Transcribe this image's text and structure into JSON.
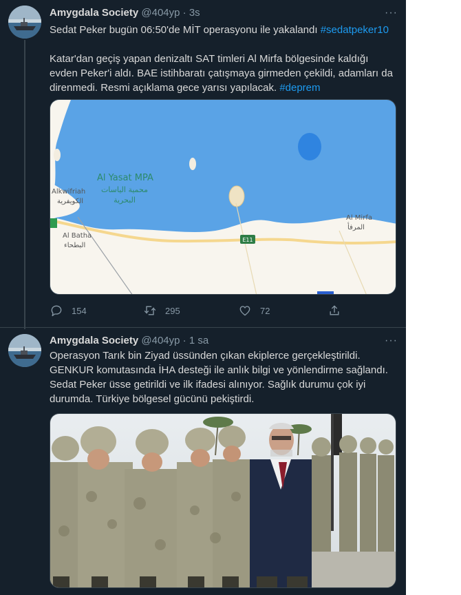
{
  "tweets": [
    {
      "author_name": "Amygdala Society",
      "author_handle": "@404yp",
      "separator": "·",
      "time": "3s",
      "more": "···",
      "text_main": "Sedat Peker bugün 06:50'de MİT operasyonu ile yakalandı",
      "hashtag_main": "#sedatpeker10",
      "text_second": "Katar'dan geçiş yapan denizaltı SAT timleri Al Mirfa bölgesinde kaldığı evden Peker'i aldı. BAE istihbaratı çatışmaya girmeden çekildi, adamları da direnmedi. Resmi açıklama gece yarısı yapılacak.",
      "hashtag_second": "#deprem",
      "map": {
        "label_mpa_en": "Al Yasat MPA",
        "label_mpa_ar_1": "محمية الياسات",
        "label_mpa_ar_2": "البحرية",
        "label_ruwais_en": "Alkwifriah",
        "label_ruwais_ar": "الكويفرية",
        "label_batha_en": "Al Batha",
        "label_batha_ar": "البطحاء",
        "label_mirfa_en": "Al Mirfa",
        "label_mirfa_ar": "المرفأ",
        "road_shield": "E11",
        "colors": {
          "water": "#5aa3e6",
          "land": "#f8f5ee",
          "road": "#f5d78e"
        }
      },
      "reply_count": "154",
      "retweet_count": "295",
      "like_count": "72"
    },
    {
      "author_name": "Amygdala Society",
      "author_handle": "@404yp",
      "separator": "·",
      "time": "1 sa",
      "more": "···",
      "text": "Operasyon Tarık bin Ziyad üssünden çıkan ekiplerce gerçekleştirildi. GENKUR komutasında İHA desteği ile anlık bilgi ve yönlendirme sağlandı. Sedat Peker üsse getirildi ve ilk ifadesi alınıyor. Sağlık durumu çok iyi durumda. Türkiye bölgesel gücünü pekiştirdi."
    }
  ],
  "theme": {
    "background": "#15202b",
    "text": "#d9d9d9",
    "secondary": "#8899a6",
    "link": "#1d9bf0",
    "border": "#38444d"
  }
}
